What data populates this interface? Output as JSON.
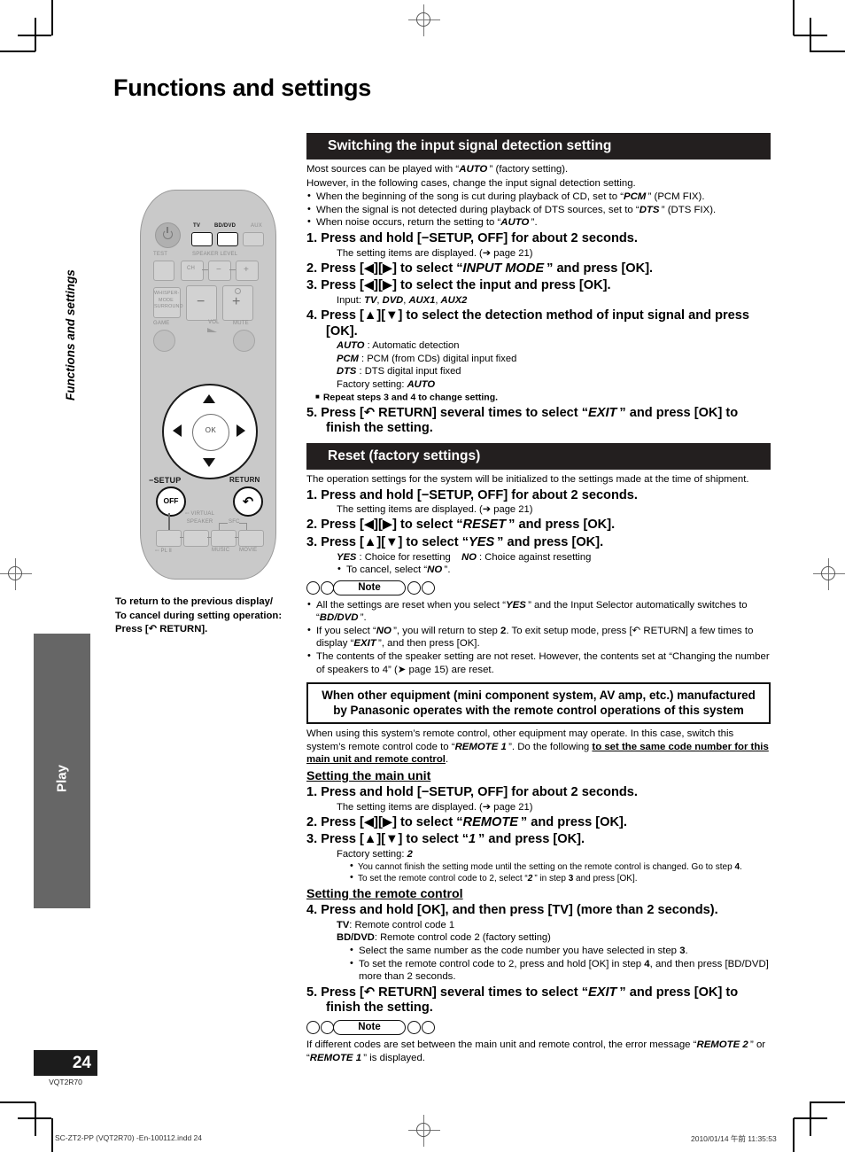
{
  "page": {
    "title": "Functions and settings",
    "sidebar_chapter": "Functions and settings",
    "sidebar_tab": "Play",
    "page_number": "24",
    "doc_code": "VQT2R70",
    "footer_left": "SC-ZT2-PP (VQT2R70) -En-100112.indd    24",
    "footer_right": "2010/01/14    午前 11:35:53"
  },
  "remote": {
    "labels": {
      "tv": "TV",
      "bddvd": "BD/DVD",
      "aux": "AUX",
      "test": "TEST",
      "speaker_level": "SPEAKER LEVEL",
      "ch": "CH",
      "minus": "−",
      "plus": "+",
      "whisper": "WHISPER-\nMODE\nSURROUND",
      "game": "GAME",
      "vol": "VOL",
      "mute": "MUTE",
      "ok": "OK",
      "setup": "−SETUP",
      "off": "OFF",
      "return": "RETURN",
      "return_glyph": "↶",
      "virtual_speaker": "VIRTUAL\nSPEAKER",
      "sfc": "SFC",
      "pl2": "PL Ⅱ",
      "music": "MUSIC",
      "movie": "MOVIE"
    },
    "caption_line1": "To return to the previous display/",
    "caption_line2": "To cancel during setting operation:",
    "caption_line3": "Press [↶ RETURN]."
  },
  "section1": {
    "heading": "Switching the input signal detection setting",
    "intro1": "Most sources can be played with “AUTO” (factory setting).",
    "intro2": "However, in the following cases, change the input signal detection setting.",
    "bullets": [
      "When the beginning of the song is cut during playback of CD, set to “PCM” (PCM FIX).",
      "When the signal is not detected during playback of DTS sources, set to “DTS” (DTS FIX).",
      "When noise occurs, return the setting to “AUTO”."
    ],
    "step1": "1. Press and hold [−SETUP, OFF] for about 2 seconds.",
    "step1_sub": "The setting items are displayed. (➔ page 21)",
    "step2": "2. Press [◀][▶] to select “INPUT MODE ” and press [OK].",
    "step3": "3. Press [◀][▶] to select the input and press [OK].",
    "step3_sub": "Input: TV, DVD, AUX1, AUX2",
    "step4": "4. Press [▲][▼] to select the detection method of input signal and press [OK].",
    "step4_subs": [
      "AUTO : Automatic detection",
      "PCM : PCM (from CDs) digital input fixed",
      "DTS : DTS digital input fixed",
      "Factory setting: AUTO"
    ],
    "step4_repeat": "Repeat steps 3 and 4 to change setting.",
    "step5": "5. Press [↶ RETURN] several times to select “EXIT ” and press [OK] to finish the setting."
  },
  "section2": {
    "heading": "Reset (factory settings)",
    "intro": "The operation settings for the system will be initialized to the settings made at the time of shipment.",
    "step1": "1. Press and hold [−SETUP, OFF] for about 2 seconds.",
    "step1_sub": "The setting items are displayed. (➔ page 21)",
    "step2": "2. Press [◀][▶] to select “RESET ” and press [OK].",
    "step3": "3. Press [▲][▼] to select “YES ” and press [OK].",
    "step3_sub": "YES : Choice for resetting     NO : Choice against resetting",
    "step3_bullet": "To cancel, select “NO ”.",
    "note_label": "Note",
    "notes": [
      "All the settings are reset when you select “YES ” and the Input Selector automatically switches to “BD/DVD ”.",
      "If you select “NO ”, you will return to step 2. To exit setup mode, press [↶ RETURN] a few times to display “EXIT ”, and then press [OK].",
      "The contents of the speaker setting are not reset. However, the contents set at “Changing the number of speakers to 4” (➔ page 15) are reset."
    ]
  },
  "section3": {
    "boxed_heading_line1": "When other equipment (mini component system, AV amp, etc.) manufactured",
    "boxed_heading_line2": "by Panasonic operates with the remote control operations of this system",
    "intro": "When using this system’s remote control, other equipment may operate. In this case, switch this system’s remote control code to “REMOTE 1 ”. Do the following to set the same code number for this main unit and remote control.",
    "subhead_main": "Setting the main unit",
    "step1": "1. Press and hold [−SETUP, OFF] for about 2 seconds.",
    "step1_sub": "The setting items are displayed. (➔ page 21)",
    "step2": "2. Press [◀][▶] to select “REMOTE ” and press [OK].",
    "step3": "3. Press [▲][▼] to select “1 ” and press [OK].",
    "step3_sub": "Factory setting: 2",
    "step3_bullets": [
      "You cannot finish the setting mode until the setting on the remote control is changed. Go to step 4.",
      "To set the remote control code to 2, select “2 ” in step 3 and press [OK]."
    ],
    "subhead_remote": "Setting the remote control",
    "step4": "4. Press and hold [OK], and then press [TV] (more than 2 seconds).",
    "step4_subs": [
      "TV: Remote control code 1",
      "BD/DVD: Remote control code 2 (factory setting)"
    ],
    "step4_bullets": [
      "Select the same number as the code number you have selected in step 3.",
      "To set the remote control code to 2, press and hold [OK] in step 4, and then press [BD/DVD] more than 2 seconds."
    ],
    "step5": "5. Press [↶ RETURN] several times to select “EXIT ” and press [OK] to finish the setting.",
    "note_label": "Note",
    "note": "If different codes are set between the main unit and remote control, the error message “REMOTE 2 ” or “REMOTE 1 ” is displayed."
  }
}
